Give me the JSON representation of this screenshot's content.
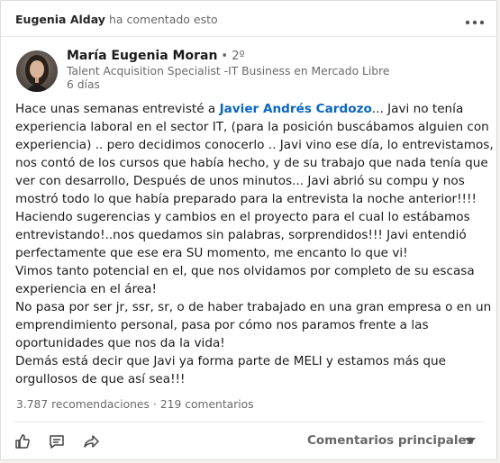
{
  "activity": {
    "actor": "Eugenia Alday",
    "verb": "ha comentado esto",
    "more_icon": "ellipsis-icon"
  },
  "author": {
    "name": "María Eugenia Moran",
    "degree": "• 2º",
    "headline": "Talent Acquisition Specialist -IT Business en Mercado Libre",
    "time": "6 días"
  },
  "post": {
    "intro": "Hace unas semanas entrevisté a ",
    "mention": "Javier Andrés Cardozo",
    "intro_rest": "... Javi no tenía",
    "lines": [
      "experiencia laboral en el sector IT, (para la posición buscábamos alguien con",
      "experiencia) .. pero decidimos conocerlo .. Javi vino ese día, lo entrevistamos,",
      "nos contó de los cursos que había hecho, y de su trabajo que nada tenía que",
      "ver con desarrollo, Después de unos minutos... Javi abrió su compu y nos",
      "mostró todo lo que había preparado para la entrevista la noche anterior!!!!",
      "Haciendo sugerencias y cambios en el proyecto para el cual lo estábamos",
      "entrevistando!..nos quedamos sin palabras, sorprendidos!!! Javi entendió",
      "perfectamente que ese era SU momento, me encanto lo que vi!",
      "Vimos tanto potencial en el, que nos olvidamos por completo de su escasa",
      "experiencia en el área!",
      "No pasa por ser jr, ssr, sr, o de haber trabajado en una gran empresa o en un",
      "emprendimiento personal, pasa por cómo nos paramos frente a las",
      "oportunidades que nos da la vida!",
      "Demás está decir que Javi ya forma parte de MELI y estamos más que",
      "orgullosos de que así sea!!!"
    ]
  },
  "social": {
    "reactions": "3.787 recomendaciones",
    "separator": "·",
    "comments": "219 comentarios"
  },
  "actions": {
    "like_icon": "thumbs-up-icon",
    "comment_icon": "comment-icon",
    "share_icon": "share-icon",
    "sort_label": "Comentarios principales",
    "sort_icon": "caret-down-icon"
  },
  "colors": {
    "link": "#0a66c2",
    "secondary_text": "#666666"
  }
}
